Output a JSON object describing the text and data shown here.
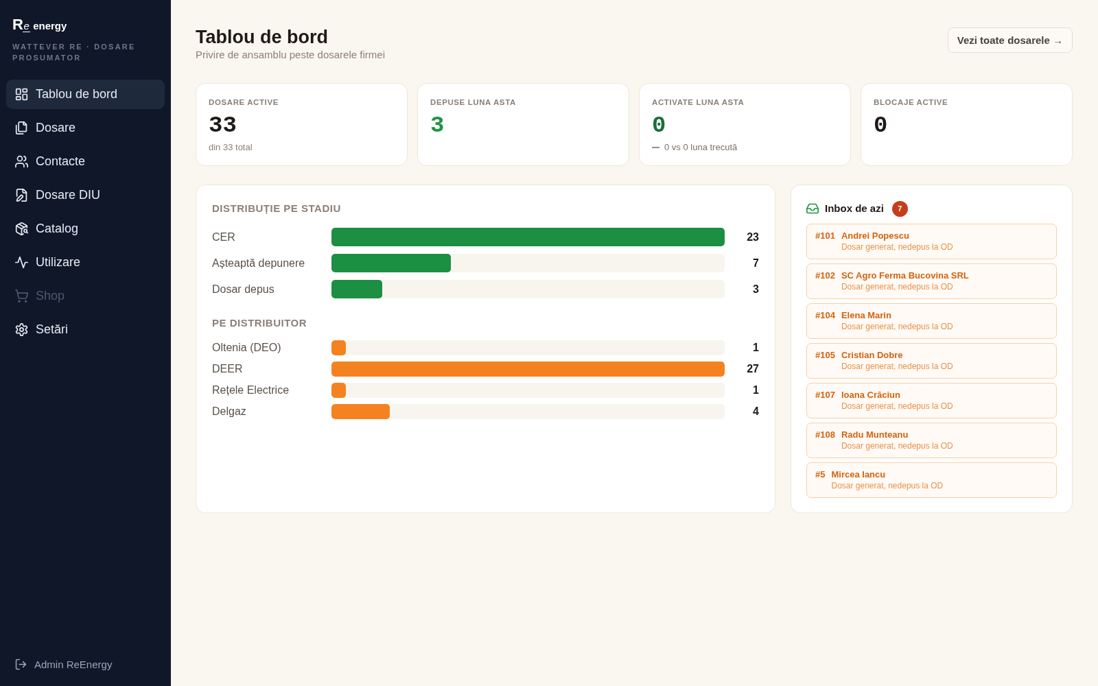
{
  "sidebar": {
    "logo": {
      "lead": "R",
      "accent": "e",
      "tail": "energy"
    },
    "subtitle": "WATTEVER RE · DOSARE PROSUMATOR",
    "items": [
      {
        "label": "Tablou de bord",
        "selected": true,
        "disabled": false
      },
      {
        "label": "Dosare",
        "selected": false,
        "disabled": false
      },
      {
        "label": "Contacte",
        "selected": false,
        "disabled": false
      },
      {
        "label": "Dosare DIU",
        "selected": false,
        "disabled": false
      },
      {
        "label": "Catalog",
        "selected": false,
        "disabled": false
      },
      {
        "label": "Utilizare",
        "selected": false,
        "disabled": false
      },
      {
        "label": "Shop",
        "selected": false,
        "disabled": true
      },
      {
        "label": "Setări",
        "selected": false,
        "disabled": false
      }
    ],
    "user": {
      "name": "Admin ReEnergy"
    }
  },
  "header": {
    "title": "Tablou de bord",
    "subtitle": "Privire de ansamblu peste dosarele firmei",
    "action": "Vezi toate dosarele →"
  },
  "stats": [
    {
      "label": "DOSARE ACTIVE",
      "value": "33",
      "color": "#1f1a17",
      "note": "din 33 total"
    },
    {
      "label": "DEPUSE LUNA ASTA",
      "value": "3",
      "color": "#1e9444"
    },
    {
      "label": "ACTIVATE LUNA ASTA",
      "value": "0",
      "color": "#17703a",
      "trend": "0 vs 0 luna trecută"
    },
    {
      "label": "BLOCAJE ACTIVE",
      "value": "0",
      "color": "#1f1a17"
    }
  ],
  "charts": [
    {
      "title": "DISTRIBUȚIE PE STADIU",
      "kind": "large",
      "color": "#1c8f42",
      "rows": [
        {
          "label": "CER",
          "count": "23",
          "level": 1
        },
        {
          "label": "Așteaptă depunere",
          "count": "7",
          "level": 0.304
        },
        {
          "label": "Dosar depus",
          "count": "3",
          "level": 0.13
        }
      ]
    },
    {
      "title": "PE DISTRIBUITOR",
      "kind": "compact",
      "color": "#f58220",
      "rows": [
        {
          "label": "Oltenia (DEO)",
          "count": "1",
          "level": 0.037
        },
        {
          "label": "DEER",
          "count": "27",
          "level": 1
        },
        {
          "label": "Rețele Electrice",
          "count": "1",
          "level": 0.037
        },
        {
          "label": "Delgaz",
          "count": "4",
          "level": 0.148
        }
      ]
    }
  ],
  "inbox": {
    "title": "Inbox de azi",
    "count": "7",
    "items": [
      {
        "number": "#101",
        "name": "Andrei Popescu",
        "status": "Dosar generat, nedepus la OD"
      },
      {
        "number": "#102",
        "name": "SC Agro Ferma Bucovina SRL",
        "status": "Dosar generat, nedepus la OD"
      },
      {
        "number": "#104",
        "name": "Elena Marin",
        "status": "Dosar generat, nedepus la OD"
      },
      {
        "number": "#105",
        "name": "Cristian Dobre",
        "status": "Dosar generat, nedepus la OD"
      },
      {
        "number": "#107",
        "name": "Ioana Crăciun",
        "status": "Dosar generat, nedepus la OD"
      },
      {
        "number": "#108",
        "name": "Radu Munteanu",
        "status": "Dosar generat, nedepus la OD"
      },
      {
        "number": "#5",
        "name": "Mircea Iancu",
        "status": "Dosar generat, nedepus la OD"
      }
    ]
  }
}
